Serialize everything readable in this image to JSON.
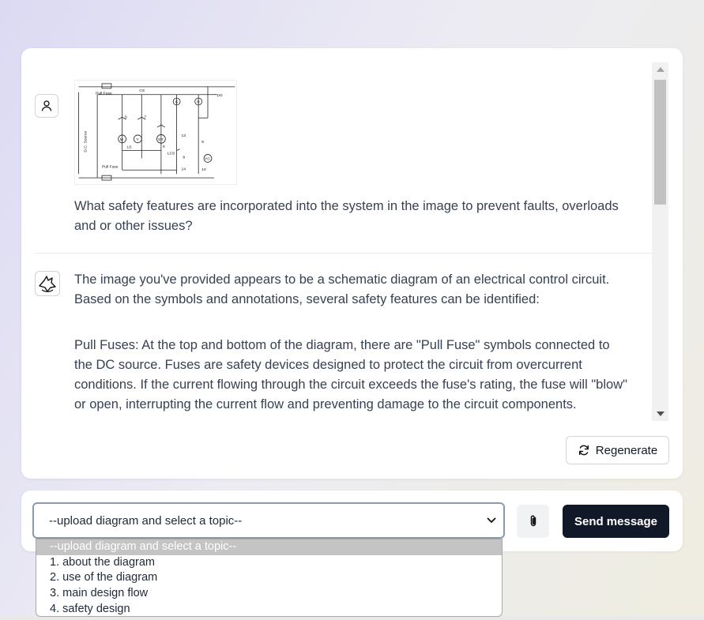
{
  "conversation": {
    "user_message": {
      "text": "What safety features are incorporated into the system in the image to prevent faults, overloads and or other issues?",
      "attachment_labels": {
        "top_fuse": "Pull Fuse",
        "bottom_fuse": "Pull Fuse",
        "source": "D.C. Source",
        "cs": "CS",
        "pr": "PR",
        "g": "G",
        "r": "R",
        "m": "M",
        "y": "Y",
        "sr": "SR",
        "yc": "YC",
        "ls": "LS",
        "lcs": "LCS",
        "b": "b",
        "a": "a",
        "s": "S",
        "n7": "7",
        "n9": "9",
        "n10": "10",
        "n13": "13",
        "n14": "14"
      }
    },
    "assistant_message": {
      "paragraph_1": "The image you've provided appears to be a schematic diagram of an electrical control circuit. Based on the symbols and annotations, several safety features can be identified:",
      "paragraph_2": "Pull Fuses: At the top and bottom of the diagram, there are \"Pull Fuse\" symbols connected to the DC source. Fuses are safety devices designed to protect the circuit from overcurrent conditions. If the current flowing through the circuit exceeds the fuse's rating, the fuse will \"blow\" or open, interrupting the current flow and preventing damage to the circuit components."
    }
  },
  "actions": {
    "regenerate_label": "Regenerate",
    "send_label": "Send message"
  },
  "topic_select": {
    "selected": "--upload diagram and select a topic--",
    "options": [
      "--upload diagram and select a topic--",
      "1. about the diagram",
      "2. use of the diagram",
      "3. main design flow",
      "4. safety design"
    ]
  },
  "icons": {
    "user": "user-icon",
    "assistant": "fox-logo-icon",
    "regenerate": "refresh-icon",
    "attach": "paperclip-icon",
    "chevron": "chevron-down-icon"
  },
  "colors": {
    "send_button": "#111827",
    "select_border": "#8a9aab",
    "dropdown_highlight": "#c4c4c4"
  }
}
